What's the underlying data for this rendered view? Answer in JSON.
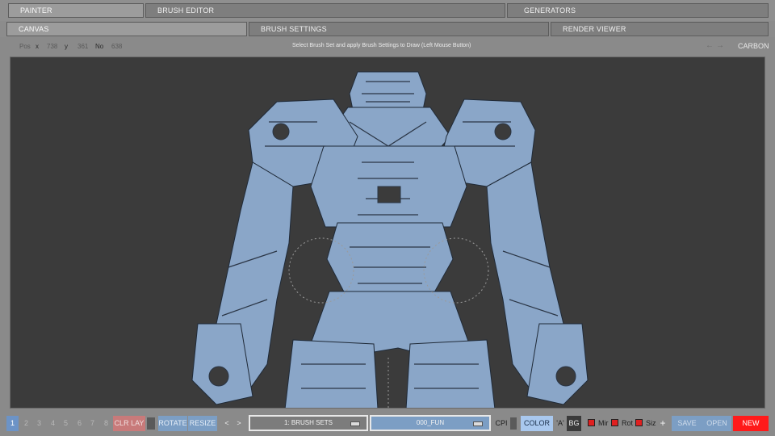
{
  "main_tabs": [
    {
      "label": "PAINTER",
      "active": true
    },
    {
      "label": "BRUSH EDITOR",
      "active": false
    },
    {
      "label": "GENERATORS",
      "active": false
    }
  ],
  "sub_tabs": [
    {
      "label": "CANVAS",
      "active": true
    },
    {
      "label": "BRUSH SETTINGS",
      "active": false
    },
    {
      "label": "RENDER VIEWER",
      "active": false
    }
  ],
  "status": {
    "pos_label": "Pos",
    "x_label": "x",
    "x_value": "738",
    "y_label": "y",
    "y_value": "361",
    "no_label": "No",
    "no_value": "638",
    "hint": "Select Brush Set and apply Brush Settings to Draw (Left Mouse Button)",
    "preset_name": "CARBON"
  },
  "toolbar": {
    "layers": [
      "1",
      "2",
      "3",
      "4",
      "5",
      "6",
      "7",
      "8"
    ],
    "selected_layer": "1",
    "clr_lay": "CLR LAY",
    "rotate": "ROTATE",
    "resize": "RESIZE",
    "prev": "<",
    "next": ">",
    "brush_set": "1: BRUSH SETS",
    "brush": "000_FUN",
    "cpi": "CPI",
    "color": "COLOR",
    "a": "'A'",
    "bg": "BG",
    "mir": "Mir",
    "rot": "Rot",
    "siz": "Siz",
    "plus": "+",
    "save": "SAVE",
    "open": "OPEN",
    "new": "NEW"
  },
  "colors": {
    "accent_blue": "#7c9ec4",
    "clr_lay_red": "#c87a7a",
    "new_red": "#ff1a1a",
    "canvas_bg": "#3b3b3b",
    "art_blue": "#8aa6c8"
  }
}
